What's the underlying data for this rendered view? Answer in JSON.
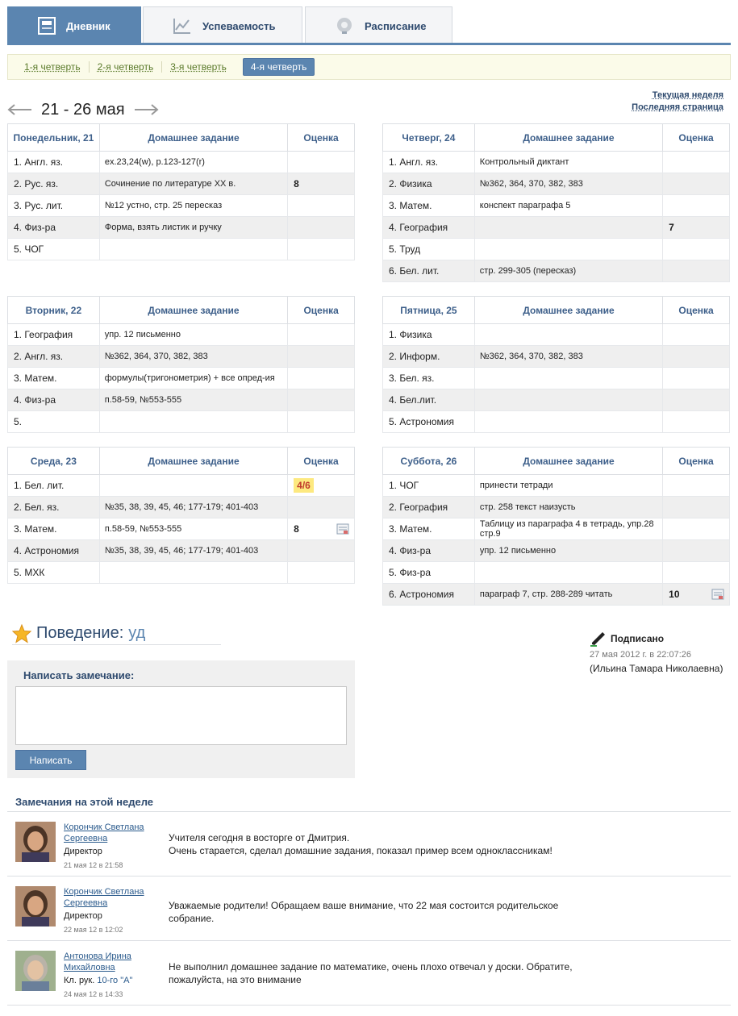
{
  "tabs": [
    {
      "label": "Дневник",
      "icon": "diary-icon"
    },
    {
      "label": "Успеваемость",
      "icon": "chart-icon"
    },
    {
      "label": "Расписание",
      "icon": "bell-icon"
    }
  ],
  "quarters": [
    "1-я четверть",
    "2-я четверть",
    "3-я четверть",
    "4-я четверть"
  ],
  "week": {
    "title": "21 - 26 мая",
    "current_week": "Текущая неделя",
    "last_page": "Последняя страница"
  },
  "columns": {
    "hw": "Домашнее задание",
    "grade": "Оценка"
  },
  "days": [
    {
      "name": "Понедельник, 21",
      "rows": [
        {
          "subject": "1. Англ. яз.",
          "hw": "ex.23,24(w), p.123-127(r)",
          "grade": ""
        },
        {
          "subject": "2. Рус. яз.",
          "hw": "Сочинение по литературе XX в.",
          "grade": "8"
        },
        {
          "subject": "3. Рус. лит.",
          "hw": "№12 устно, стр. 25 пересказ",
          "grade": ""
        },
        {
          "subject": "4. Физ-ра",
          "hw": "Форма, взять листик и ручку",
          "grade": ""
        },
        {
          "subject": "5. ЧОГ",
          "hw": "",
          "grade": ""
        }
      ]
    },
    {
      "name": "Четверг, 24",
      "rows": [
        {
          "subject": "1. Англ. яз.",
          "hw": "Контрольный диктант",
          "grade": ""
        },
        {
          "subject": "2. Физика",
          "hw": "№362, 364, 370, 382, 383",
          "grade": ""
        },
        {
          "subject": "3. Матем.",
          "hw": "конспект параграфа 5",
          "grade": ""
        },
        {
          "subject": "4. География",
          "hw": "",
          "grade": "7"
        },
        {
          "subject": "5. Труд",
          "hw": "",
          "grade": ""
        },
        {
          "subject": "6. Бел. лит.",
          "hw": "стр. 299-305 (пересказ)",
          "grade": ""
        }
      ]
    },
    {
      "name": "Вторник, 22",
      "rows": [
        {
          "subject": "1. География",
          "hw": "упр. 12 письменно",
          "grade": ""
        },
        {
          "subject": "2. Англ. яз.",
          "hw": "№362, 364, 370, 382, 383",
          "grade": ""
        },
        {
          "subject": "3. Матем.",
          "hw": "формулы(тригонометрия) + все опред-ия",
          "grade": ""
        },
        {
          "subject": "4. Физ-ра",
          "hw": "п.58-59, №553-555",
          "grade": ""
        },
        {
          "subject": "5.",
          "hw": "",
          "grade": ""
        }
      ]
    },
    {
      "name": "Пятница, 25",
      "rows": [
        {
          "subject": "1. Физика",
          "hw": "",
          "grade": ""
        },
        {
          "subject": "2. Информ.",
          "hw": "№362, 364, 370, 382, 383",
          "grade": ""
        },
        {
          "subject": "3. Бел. яз.",
          "hw": "",
          "grade": ""
        },
        {
          "subject": "4. Бел.лит.",
          "hw": "",
          "grade": ""
        },
        {
          "subject": "5. Астрономия",
          "hw": "",
          "grade": ""
        }
      ]
    },
    {
      "name": "Среда, 23",
      "rows": [
        {
          "subject": "1. Бел. лит.",
          "hw": "",
          "grade": "4/6"
        },
        {
          "subject": "2. Бел. яз.",
          "hw": "№35, 38, 39, 45, 46; 177-179; 401-403",
          "grade": ""
        },
        {
          "subject": "3. Матем.",
          "hw": "п.58-59, №553-555",
          "grade": "8"
        },
        {
          "subject": "4. Астрономия",
          "hw": "№35, 38, 39, 45, 46; 177-179; 401-403",
          "grade": ""
        },
        {
          "subject": "5. МХК",
          "hw": "",
          "grade": ""
        }
      ]
    },
    {
      "name": "Суббота, 26",
      "rows": [
        {
          "subject": "1. ЧОГ",
          "hw": "принести тетради",
          "grade": ""
        },
        {
          "subject": "2. География",
          "hw": "стр. 258 текст наизусть",
          "grade": ""
        },
        {
          "subject": "3. Матем.",
          "hw": "Таблицу из параграфа 4 в тетрадь, упр.28 стр.9",
          "grade": ""
        },
        {
          "subject": "4. Физ-ра",
          "hw": "упр. 12 письменно",
          "grade": ""
        },
        {
          "subject": "5. Физ-ра",
          "hw": "",
          "grade": ""
        },
        {
          "subject": "6. Астрономия",
          "hw": "параграф 7, стр. 288-289 читать",
          "grade": "10"
        }
      ]
    }
  ],
  "behavior": {
    "label": "Поведение:",
    "value": "уд"
  },
  "signed": {
    "title": "Подписано",
    "date": "27 мая 2012 г. в 22:07:26",
    "name": "(Ильина Тамара Николаевна)"
  },
  "form": {
    "title": "Написать замечание:",
    "button": "Написать"
  },
  "comments_title": "Замечания на этой неделе",
  "comments": [
    {
      "author": "Корончик Светлана Сергеевна",
      "role": "Директор",
      "date": "21 мая 12 в 21:58",
      "text": "Учителя сегодня в восторге от Дмитрия.\nОчень старается, сделал домашние задания, показал пример всем одноклассникам!"
    },
    {
      "author": "Корончик Светлана Сергеевна",
      "role": "Директор",
      "date": "22 мая 12 в 12:02",
      "text": "Уважаемые родители! Обращаем ваше внимание, что 22 мая состоится родительское собрание."
    },
    {
      "author": "Антонова Ирина Михайловна",
      "role": "Кл. рук.",
      "role_link": "10-го \"А\"",
      "date": "24 мая 12 в 14:33",
      "text": "Не выполнил домашнее задание по математике, очень плохо отвечал у доски. Обратите, пожалуйста, на это внимание"
    }
  ],
  "colors": {
    "accent": "#5b85b0",
    "header_text": "#3d5f8a",
    "badge_bg": "#fde980",
    "badge_text": "#c0392b"
  }
}
